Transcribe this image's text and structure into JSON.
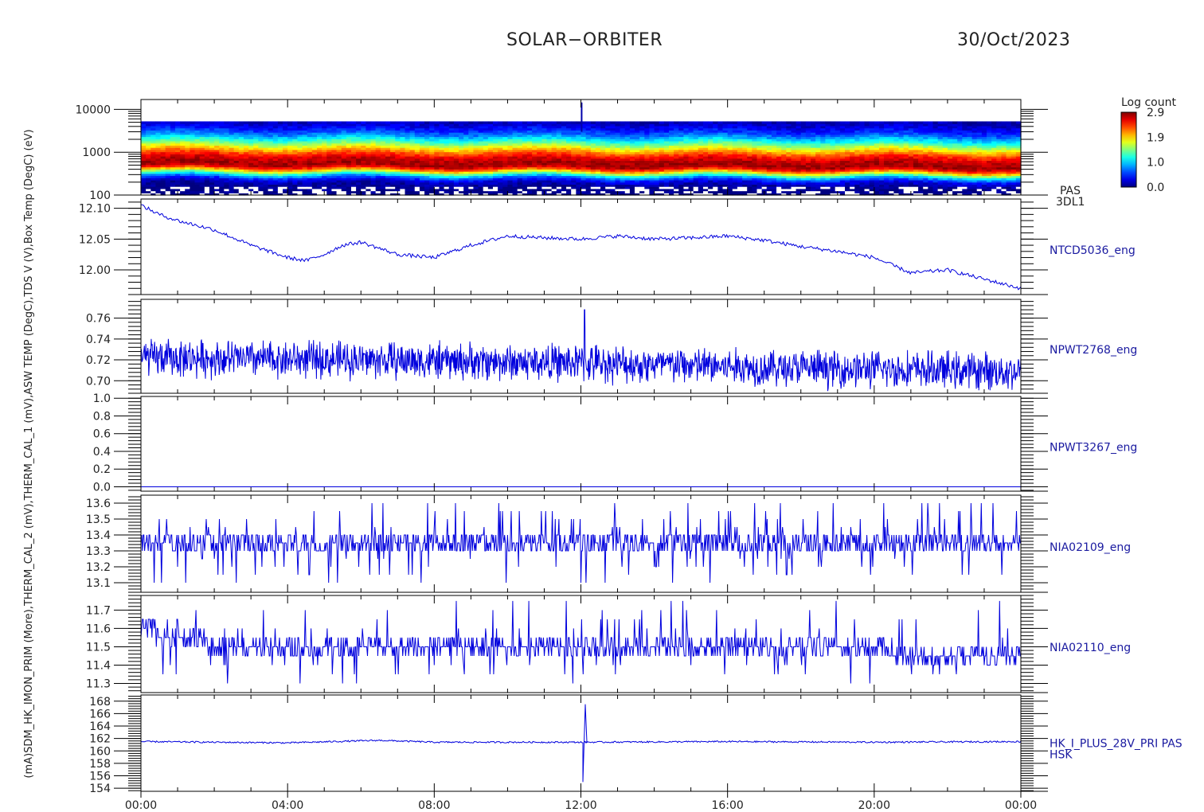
{
  "header": {
    "title": "SOLAR−ORBITER",
    "date": "30/Oct/2023"
  },
  "colors": {
    "axis": "#000000",
    "trace": "#0000dd",
    "label": "#1a1aa0",
    "tick_text": "#222222"
  },
  "chart_data": [
    {
      "type": "heatmap",
      "title": "",
      "ylabel": "(eV)",
      "yscale": "log",
      "ylim": [
        100,
        17000
      ],
      "yticks": [
        {
          "v": 100,
          "label": "100"
        },
        {
          "v": 1000,
          "label": "1000"
        },
        {
          "v": 10000,
          "label": "10000"
        }
      ],
      "xlim": [
        0,
        24
      ],
      "band_log_energy_peak_start": 2.76,
      "band_log_energy_peak_end": 2.66,
      "spike_time_hours": 12.02,
      "colorbar": {
        "title": "Log count",
        "ticks": [
          "2.9",
          "1.9",
          "1.0",
          "0.0"
        ],
        "min": 0.0,
        "max": 2.9
      },
      "right_labels": [
        "PAS",
        "3DL1"
      ]
    },
    {
      "type": "line",
      "ylabel": "Box Temp (DegC)",
      "ylim": [
        11.96,
        12.115
      ],
      "yticks": [
        {
          "v": 12.0,
          "label": "12.00"
        },
        {
          "v": 12.05,
          "label": "12.05"
        },
        {
          "v": 12.1,
          "label": "12.10"
        }
      ],
      "right_labels": [
        "NTCD5036_eng"
      ],
      "x": [
        0,
        0.5,
        1,
        2,
        3,
        4,
        4.5,
        5,
        5.5,
        6,
        7,
        8,
        9,
        10,
        11,
        12,
        13,
        14,
        15,
        16,
        17,
        18,
        19,
        20,
        21,
        22,
        23,
        24
      ],
      "values": [
        12.105,
        12.09,
        12.08,
        12.065,
        12.04,
        12.02,
        12.015,
        12.025,
        12.04,
        12.045,
        12.025,
        12.02,
        12.04,
        12.055,
        12.052,
        12.05,
        12.055,
        12.05,
        12.052,
        12.055,
        12.048,
        12.038,
        12.03,
        12.02,
        11.995,
        12.0,
        11.985,
        11.97
      ]
    },
    {
      "type": "line",
      "ylabel": "TDS V",
      "ylim": [
        0.688,
        0.778
      ],
      "yticks": [
        {
          "v": 0.7,
          "label": "0.70"
        },
        {
          "v": 0.72,
          "label": "0.72"
        },
        {
          "v": 0.74,
          "label": "0.74"
        },
        {
          "v": 0.76,
          "label": "0.76"
        }
      ],
      "right_labels": [
        "NPWT2768_eng"
      ],
      "baseline": {
        "x": [
          0,
          6,
          12,
          18,
          24
        ],
        "values": [
          0.722,
          0.72,
          0.717,
          0.712,
          0.709
        ]
      },
      "noise_amplitude": 0.018,
      "spike": {
        "x": 12.1,
        "value": 0.768
      }
    },
    {
      "type": "line",
      "ylabel": "ASW TEMP",
      "ylim": [
        -0.05,
        1.02
      ],
      "yticks": [
        {
          "v": 0.0,
          "label": "0.0"
        },
        {
          "v": 0.2,
          "label": "0.2"
        },
        {
          "v": 0.4,
          "label": "0.4"
        },
        {
          "v": 0.6,
          "label": "0.6"
        },
        {
          "v": 0.8,
          "label": "0.8"
        },
        {
          "v": 1.0,
          "label": "1.0"
        }
      ],
      "right_labels": [
        "NPWT3267_eng"
      ],
      "x": [
        0,
        24
      ],
      "values": [
        0.0,
        0.0
      ]
    },
    {
      "type": "line",
      "ylabel": "THERM_CAL_1",
      "ylim": [
        13.04,
        13.65
      ],
      "yticks": [
        {
          "v": 13.1,
          "label": "13.1"
        },
        {
          "v": 13.2,
          "label": "13.2"
        },
        {
          "v": 13.3,
          "label": "13.3"
        },
        {
          "v": 13.4,
          "label": "13.4"
        },
        {
          "v": 13.5,
          "label": "13.5"
        },
        {
          "v": 13.6,
          "label": "13.6"
        }
      ],
      "right_labels": [
        "NIA02109_eng"
      ],
      "levels": [
        13.3,
        13.35,
        13.4
      ],
      "quantum": 0.05,
      "spike_range": [
        13.1,
        13.6
      ]
    },
    {
      "type": "line",
      "ylabel": "THERM_CAL_2",
      "ylim": [
        11.25,
        11.78
      ],
      "yticks": [
        {
          "v": 11.3,
          "label": "11.3"
        },
        {
          "v": 11.4,
          "label": "11.4"
        },
        {
          "v": 11.5,
          "label": "11.5"
        },
        {
          "v": 11.6,
          "label": "11.6"
        },
        {
          "v": 11.7,
          "label": "11.7"
        }
      ],
      "right_labels": [
        "NIA02110_eng"
      ],
      "level_segments": [
        {
          "x": [
            0,
            0.4
          ],
          "v": 11.6
        },
        {
          "x": [
            0.4,
            1.8
          ],
          "v": 11.55
        },
        {
          "x": [
            1.8,
            20.5
          ],
          "v": 11.5
        },
        {
          "x": [
            20.5,
            24
          ],
          "v": 11.45
        }
      ],
      "quantum": 0.05,
      "spike_range": [
        11.3,
        11.75
      ]
    },
    {
      "type": "line",
      "ylabel": "PSDM_HK_IMON_PRIM (mA)",
      "ylim": [
        153.5,
        169
      ],
      "yticks": [
        {
          "v": 154,
          "label": "154"
        },
        {
          "v": 156,
          "label": "156"
        },
        {
          "v": 158,
          "label": "158"
        },
        {
          "v": 160,
          "label": "160"
        },
        {
          "v": 162,
          "label": "162"
        },
        {
          "v": 164,
          "label": "164"
        },
        {
          "v": 166,
          "label": "166"
        },
        {
          "v": 168,
          "label": "168"
        }
      ],
      "right_labels": [
        "HK_I_PLUS_28V_PRI PAS",
        "HSK"
      ],
      "x": [
        0,
        4,
        6.5,
        8,
        12,
        16,
        20,
        24
      ],
      "values": [
        161.5,
        161.3,
        161.7,
        161.4,
        161.4,
        161.5,
        161.4,
        161.5
      ],
      "spike": {
        "x": 12.05,
        "min": 155.0,
        "max": 167.5
      }
    }
  ],
  "xaxis": {
    "range_hours": [
      0,
      24
    ],
    "ticks": [
      {
        "h": 0,
        "label": "00:00"
      },
      {
        "h": 4,
        "label": "04:00"
      },
      {
        "h": 8,
        "label": "08:00"
      },
      {
        "h": 12,
        "label": "12:00"
      },
      {
        "h": 16,
        "label": "16:00"
      },
      {
        "h": 20,
        "label": "20:00"
      },
      {
        "h": 24,
        "label": "00:00"
      }
    ]
  },
  "left_axis_label": "(mA)SDM_HK_IMON_PRIM (More),THERM_CAL_2 (mV),THERM_CAL_1 (mV),ASW TEMP (DegC),TDS V (V),Box Temp (DegC) (eV)"
}
